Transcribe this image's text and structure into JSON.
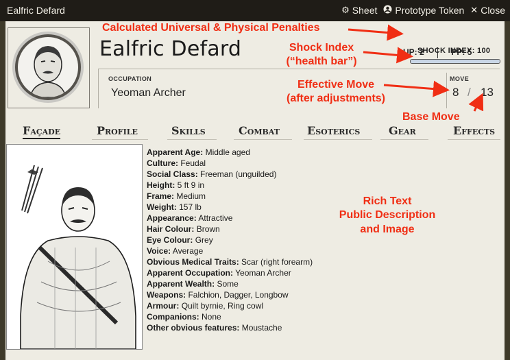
{
  "window": {
    "title": "Ealfric Defard",
    "controls": [
      {
        "icon": "gear-icon",
        "label": "Sheet"
      },
      {
        "icon": "user-circle-icon",
        "label": "Prototype Token"
      },
      {
        "icon": "close-icon",
        "label": "Close"
      }
    ]
  },
  "header": {
    "name": "Ealfric Defard",
    "up_label": "UP:",
    "up_value": "2",
    "pp_label": "PP:",
    "pp_value": "5",
    "shock_label": "SHOCK INDEX:",
    "shock_value": "100",
    "shock_fraction": 1.0,
    "occupation_label": "OCCUPATION",
    "occupation": "Yeoman Archer",
    "move_label": "MOVE",
    "move_effective": "8",
    "move_slash": "/",
    "move_base": "13"
  },
  "tabs": [
    "Façade",
    "Profile",
    "Skills",
    "Combat",
    "Esoterics",
    "Gear",
    "Effects"
  ],
  "active_tab": "Façade",
  "description": [
    {
      "key": "Apparent Age:",
      "value": "Middle aged"
    },
    {
      "key": "Culture:",
      "value": "Feudal"
    },
    {
      "key": "Social Class:",
      "value": "Freeman (unguilded)"
    },
    {
      "key": "Height:",
      "value": "5 ft 9 in"
    },
    {
      "key": "Frame:",
      "value": "Medium"
    },
    {
      "key": "Weight:",
      "value": "157 lb"
    },
    {
      "key": "Appearance:",
      "value": "Attractive"
    },
    {
      "key": "Hair Colour:",
      "value": "Brown"
    },
    {
      "key": "Eye Colour:",
      "value": "Grey"
    },
    {
      "key": "Voice:",
      "value": "Average"
    },
    {
      "key": "Obvious Medical Traits:",
      "value": "Scar (right forearm)"
    },
    {
      "key": "Apparent Occupation:",
      "value": "Yeoman Archer"
    },
    {
      "key": "Apparent Wealth:",
      "value": "Some"
    },
    {
      "key": "Weapons:",
      "value": "Falchion, Dagger, Longbow"
    },
    {
      "key": "Armour:",
      "value": "Quilt byrnie, Ring cowl"
    },
    {
      "key": "Companions:",
      "value": "None"
    },
    {
      "key": "Other obvious features:",
      "value": "Moustache"
    }
  ],
  "annotations": {
    "penalties": "Calculated Universal & Physical Penalties",
    "shock_1": "Shock Index",
    "shock_2": "(“health bar”)",
    "move_1": "Effective Move",
    "move_2": "(after adjustments)",
    "base_move": "Base Move",
    "rich_1": "Rich Text",
    "rich_2": "Public Description",
    "rich_3": "and Image"
  },
  "colors": {
    "annotation": "#f02e14",
    "sheet_bg": "#eeece3",
    "titlebar_bg": "#1f1c17"
  }
}
